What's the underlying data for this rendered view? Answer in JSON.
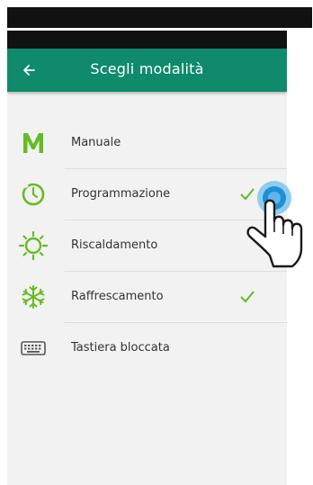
{
  "app_bar": {
    "title": "Scegli modalità",
    "back_icon": "back-arrow-icon"
  },
  "modes": [
    {
      "label": "Manuale",
      "icon": "manual-m-icon",
      "selected": false
    },
    {
      "label": "Programmazione",
      "icon": "schedule-clock-icon",
      "selected": true
    },
    {
      "label": "Riscaldamento",
      "icon": "heating-sun-icon",
      "selected": false
    },
    {
      "label": "Raffrescamento",
      "icon": "cooling-snowflake-icon",
      "selected": true
    },
    {
      "label": "Tastiera bloccata",
      "icon": "keyboard-lock-icon",
      "selected": false
    }
  ],
  "colors": {
    "header": "#0f8a6a",
    "accent_green": "#66bb22",
    "touch_blue": "#1e90d6",
    "background": "#f2f2f2"
  }
}
